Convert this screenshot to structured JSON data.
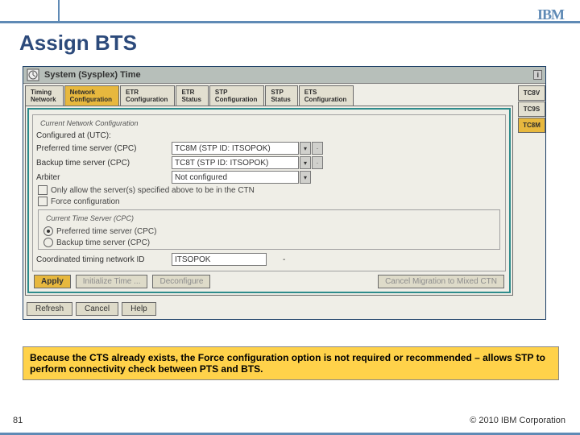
{
  "header": {
    "logo": "IBM"
  },
  "title": "Assign BTS",
  "window": {
    "title": "System (Sysplex) Time",
    "tabs": [
      {
        "l1": "Timing",
        "l2": "Network"
      },
      {
        "l1": "Network",
        "l2": "Configuration"
      },
      {
        "l1": "ETR",
        "l2": "Configuration"
      },
      {
        "l1": "ETR",
        "l2": "Status"
      },
      {
        "l1": "STP",
        "l2": "Configuration"
      },
      {
        "l1": "STP",
        "l2": "Status"
      },
      {
        "l1": "ETS",
        "l2": "Configuration"
      }
    ],
    "vtabs": [
      "TC8V",
      "TC9S",
      "TC8M"
    ],
    "group": {
      "legend": "Current Network Configuration",
      "configured": "Configured at (UTC):",
      "labels": {
        "pts": "Preferred time server (CPC)",
        "bts": "Backup time server (CPC)",
        "arb": "Arbiter"
      },
      "values": {
        "pts": "TC8M (STP ID: ITSOPOK)",
        "bts": "TC8T (STP ID: ITSOPOK)",
        "arb": "Not configured"
      },
      "chk_only": "Only allow the server(s) specified above to be in the CTN",
      "chk_force": "Force configuration"
    },
    "ctsGroup": {
      "legend": "Current Time Server (CPC)",
      "pts": "Preferred time server (CPC)",
      "bts": "Backup time server (CPC)"
    },
    "ctn": {
      "label": "Coordinated timing network ID",
      "value": "ITSOPOK"
    },
    "buttons": {
      "apply": "Apply",
      "init": "Initialize Time ...",
      "deconf": "Deconfigure",
      "cancel_mig": "Cancel Migration to Mixed CTN"
    },
    "footer": {
      "refresh": "Refresh",
      "cancel": "Cancel",
      "help": "Help"
    }
  },
  "callout": "Because the CTS already exists, the Force configuration option is not required or recommended – allows STP to perform connectivity check between PTS and BTS.",
  "page": "81",
  "copyright": "© 2010 IBM Corporation"
}
